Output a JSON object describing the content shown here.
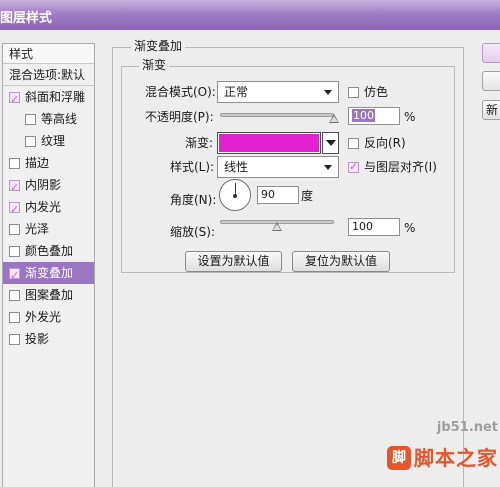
{
  "window": {
    "title": "图层样式"
  },
  "styles_panel": {
    "header": "样式",
    "blend_options": "混合选项:默认",
    "items": [
      {
        "label": "斜面和浮雕",
        "checked": true,
        "sub": false,
        "selected": false
      },
      {
        "label": "等高线",
        "checked": false,
        "sub": true,
        "selected": false
      },
      {
        "label": "纹理",
        "checked": false,
        "sub": true,
        "selected": false
      },
      {
        "label": "描边",
        "checked": false,
        "sub": false,
        "selected": false
      },
      {
        "label": "内阴影",
        "checked": true,
        "sub": false,
        "selected": false
      },
      {
        "label": "内发光",
        "checked": true,
        "sub": false,
        "selected": false
      },
      {
        "label": "光泽",
        "checked": false,
        "sub": false,
        "selected": false
      },
      {
        "label": "颜色叠加",
        "checked": false,
        "sub": false,
        "selected": false
      },
      {
        "label": "渐变叠加",
        "checked": true,
        "sub": false,
        "selected": true
      },
      {
        "label": "图案叠加",
        "checked": false,
        "sub": false,
        "selected": false
      },
      {
        "label": "外发光",
        "checked": false,
        "sub": false,
        "selected": false
      },
      {
        "label": "投影",
        "checked": false,
        "sub": false,
        "selected": false
      }
    ]
  },
  "gradient_overlay": {
    "section_title": "渐变叠加",
    "group_title": "渐变",
    "blend_mode_label": "混合模式(O):",
    "blend_mode_value": "正常",
    "dither_label": "仿色",
    "dither_checked": false,
    "opacity_label": "不透明度(P):",
    "opacity_value": "100",
    "opacity_unit": "%",
    "opacity_level": 1.0,
    "gradient_label": "渐变:",
    "gradient_color": "#e21fd1",
    "reverse_label": "反向(R)",
    "reverse_checked": false,
    "style_label": "样式(L):",
    "style_value": "线性",
    "align_label": "与图层对齐(I)",
    "align_checked": true,
    "angle_label": "角度(N):",
    "angle_value": "90",
    "angle_unit": "度",
    "scale_label": "缩放(S):",
    "scale_value": "100",
    "scale_unit": "%",
    "scale_level": 0.5,
    "set_default_button": "设置为默认值",
    "reset_default_button": "复位为默认值"
  },
  "right_buttons": [
    "",
    "",
    "新"
  ],
  "watermark": {
    "url": "jb51.net",
    "brand": "脚本之家",
    "icon_text": "脚"
  },
  "colors": {
    "accent": "#9a75c2",
    "titlebar": "#a27dc6",
    "gradient": "#e21fd1"
  }
}
